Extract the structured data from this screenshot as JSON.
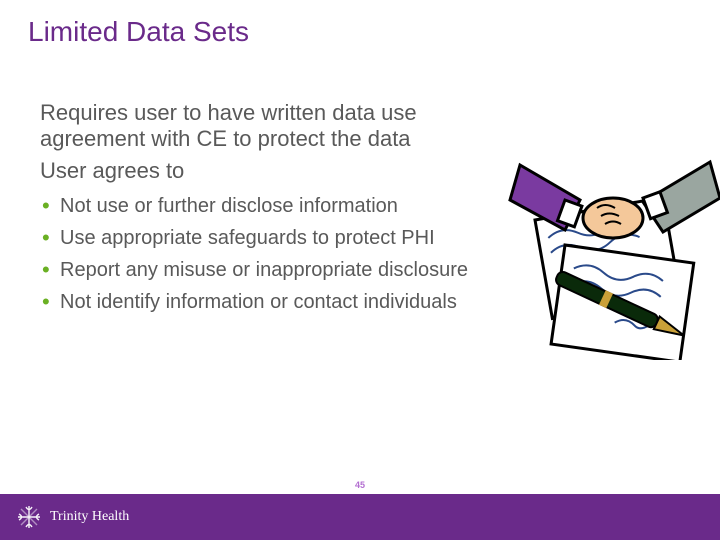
{
  "title": "Limited Data Sets",
  "lead1": "Requires user to have written data use agreement with CE to protect the data",
  "lead2": "User agrees to",
  "bullets": [
    "Not use or further disclose information",
    "Use appropriate safeguards to protect PHI",
    "Report any misuse or inappropriate disclosure",
    "Not identify information or contact individuals"
  ],
  "page_number": "45",
  "brand": "Trinity Health",
  "colors": {
    "accent": "#6a2a8a",
    "bullet": "#6ab023",
    "text": "#595959"
  }
}
